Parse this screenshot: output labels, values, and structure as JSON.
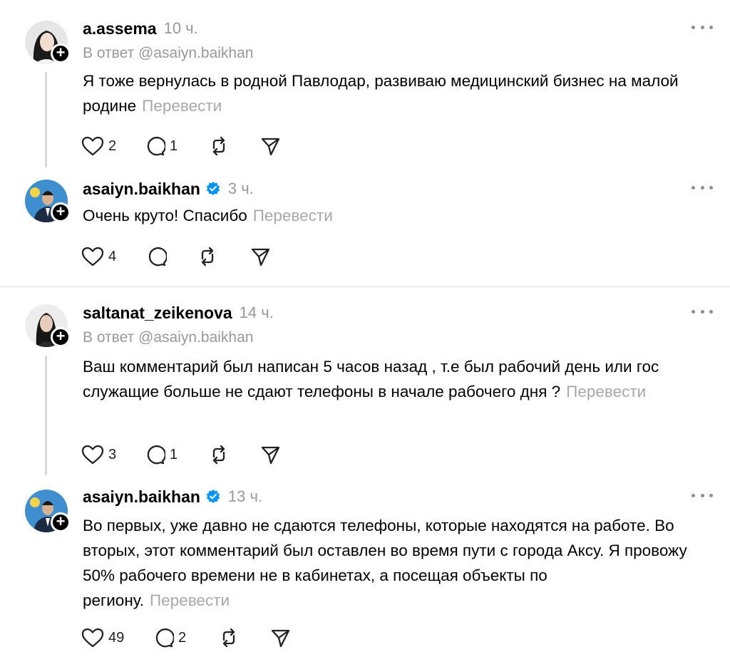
{
  "threads": [
    {
      "reply": {
        "username": "a.assema",
        "time": "10 ч.",
        "reply_to": "В ответ @asaiyn.baikhan",
        "text": "Я тоже вернулась в родной Павлодар, развиваю медицинский бизнес на малой родине",
        "translate": "Перевести",
        "likes": "2",
        "comments": "1"
      },
      "answer": {
        "username": "asaiyn.baikhan",
        "time": "3 ч.",
        "text": "Очень круто! Спасибо",
        "translate": "Перевести",
        "likes": "4",
        "comments": ""
      }
    },
    {
      "reply": {
        "username": "saltanat_zeikenova",
        "time": "14 ч.",
        "reply_to": "В ответ @asaiyn.baikhan",
        "text": "Ваш комментарий был написан 5 часов назад , т.е был рабочий день или гос служащие больше не сдают телефоны в начале рабочего дня ?",
        "translate": "Перевести",
        "likes": "3",
        "comments": "1"
      },
      "answer": {
        "username": "asaiyn.baikhan",
        "time": "13 ч.",
        "text": "Во первых, уже давно не сдаются телефоны, которые находятся на работе. Во вторых, этот комментарий был оставлен во время пути с города Аксу. Я провожу 50% рабочего времени не в кабинетах, а посещая объекты по региону.",
        "translate": "Перевести",
        "likes": "49",
        "comments": "2"
      }
    }
  ],
  "colors": {
    "verified": "#0095f6",
    "muted": "#999999",
    "divider": "#dcdcdc"
  },
  "icons": [
    "heart-icon",
    "comment-icon",
    "repost-icon",
    "share-icon",
    "more-icon",
    "verified-badge-icon",
    "follow-plus-icon"
  ]
}
